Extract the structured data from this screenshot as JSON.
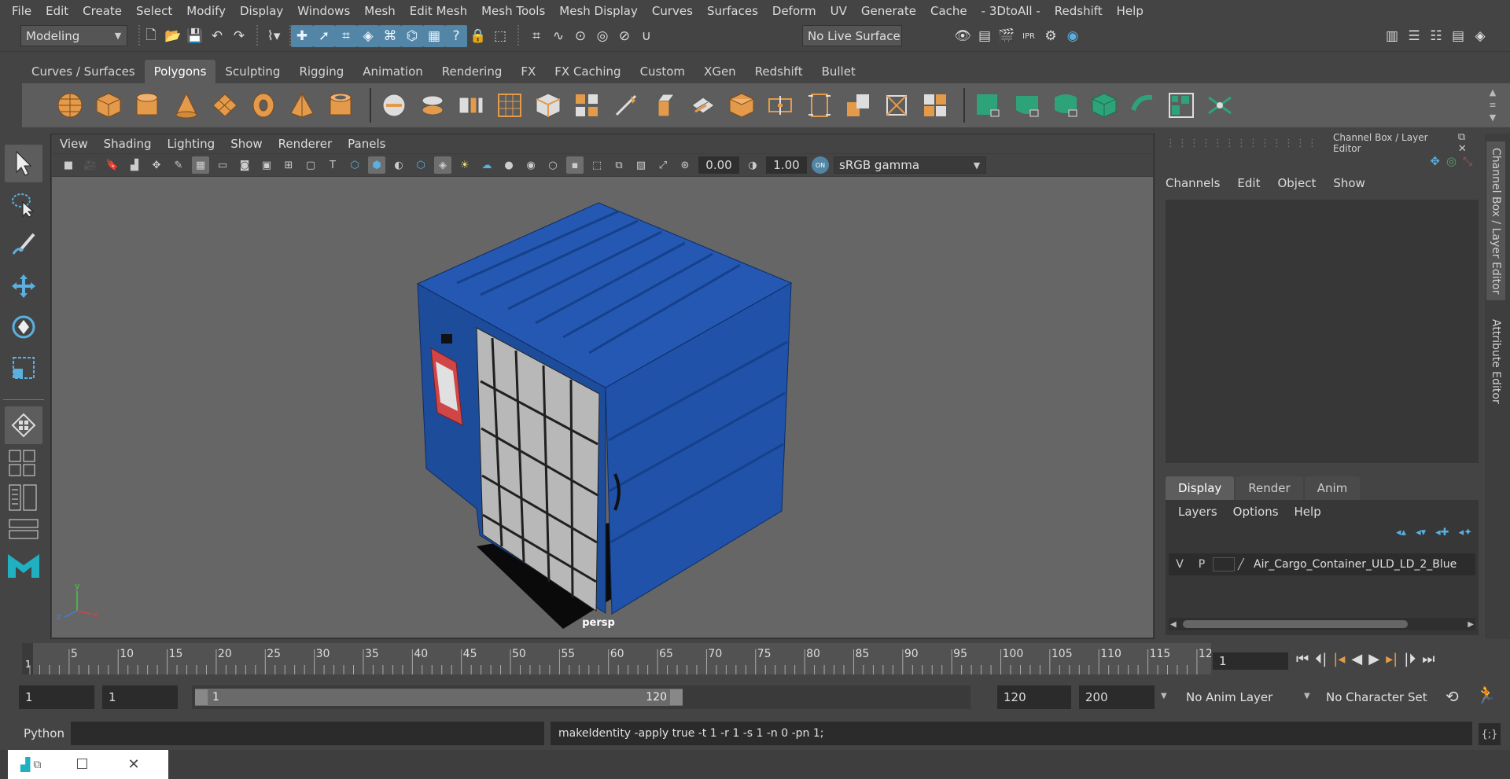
{
  "menubar": {
    "items": [
      "File",
      "Edit",
      "Create",
      "Select",
      "Modify",
      "Display",
      "Windows",
      "Mesh",
      "Edit Mesh",
      "Mesh Tools",
      "Mesh Display",
      "Curves",
      "Surfaces",
      "Deform",
      "UV",
      "Generate",
      "Cache",
      "- 3DtoAll -",
      "Redshift",
      "Help"
    ]
  },
  "statusline": {
    "workspace": "Modeling",
    "live_surface": "No Live Surface"
  },
  "shelf": {
    "tabs": [
      "Curves / Surfaces",
      "Polygons",
      "Sculpting",
      "Rigging",
      "Animation",
      "Rendering",
      "FX",
      "FX Caching",
      "Custom",
      "XGen",
      "Redshift",
      "Bullet"
    ],
    "active_tab": "Polygons"
  },
  "viewport": {
    "menu": [
      "View",
      "Shading",
      "Lighting",
      "Show",
      "Renderer",
      "Panels"
    ],
    "exposure": "0.00",
    "gamma": "1.00",
    "color_space": "sRGB gamma",
    "camera_label": "persp",
    "background_color": "#666666"
  },
  "channelbox": {
    "title": "Channel Box / Layer Editor",
    "menu": [
      "Channels",
      "Edit",
      "Object",
      "Show"
    ]
  },
  "layer_editor": {
    "tabs": [
      "Display",
      "Render",
      "Anim"
    ],
    "active_tab": "Display",
    "menu": [
      "Layers",
      "Options",
      "Help"
    ],
    "layer": {
      "v": "V",
      "p": "P",
      "name": "Air_Cargo_Container_ULD_LD_2_Blue"
    }
  },
  "side_tabs": [
    "Channel Box / Layer Editor",
    "Attribute Editor"
  ],
  "timeslider": {
    "ticks": [
      "1",
      "5",
      "10",
      "15",
      "20",
      "25",
      "30",
      "35",
      "40",
      "45",
      "50",
      "55",
      "60",
      "65",
      "70",
      "75",
      "80",
      "85",
      "90",
      "95",
      "100",
      "105",
      "110",
      "115",
      "12"
    ],
    "current_frame": "1"
  },
  "rangebar": {
    "start": "1",
    "playback_start": "1",
    "range_start_label": "1",
    "range_end_label": "120",
    "playback_end": "120",
    "end": "200",
    "anim_layer": "No Anim Layer",
    "character_set": "No Character Set"
  },
  "cmdline": {
    "language": "Python",
    "output": "makeIdentity -apply true -t 1 -r 1 -s 1 -n 0 -pn 1;"
  },
  "colors": {
    "accent_blue": "#5285a6",
    "container_blue": "#1f4fa0",
    "shelf_orange": "#e39a4a",
    "shelf_green": "#2ea37a",
    "layer_red": "#d04545"
  }
}
